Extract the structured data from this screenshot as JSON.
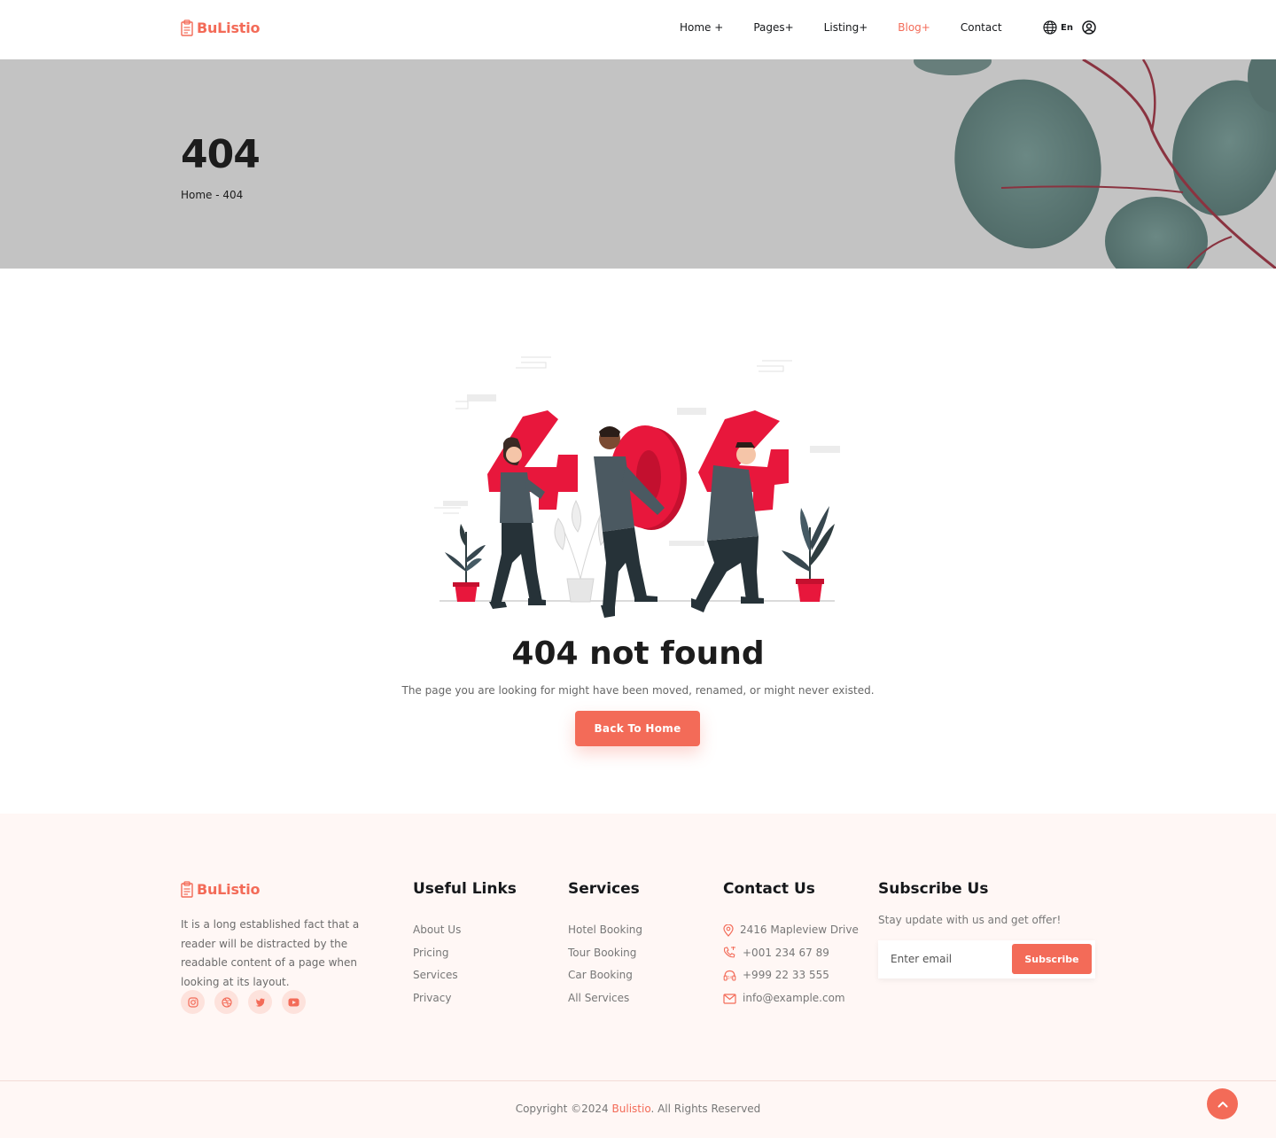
{
  "header": {
    "brand": "BuListio",
    "nav": [
      {
        "label": "Home +",
        "active": false
      },
      {
        "label": "Pages+",
        "active": false
      },
      {
        "label": "Listing+",
        "active": false
      },
      {
        "label": "Blog+",
        "active": true
      },
      {
        "label": "Contact",
        "active": false
      }
    ],
    "language": "En",
    "icons": [
      "globe-icon",
      "user-icon"
    ]
  },
  "hero": {
    "title": "404",
    "breadcrumb": "Home - 404"
  },
  "main": {
    "heading": "404 not found",
    "message": "The page you are looking for might have been moved, renamed, or might never existed.",
    "button": "Back To Home"
  },
  "footer": {
    "brand": "BuListio",
    "about": "It is a long established fact that a reader will be distracted by the readable content of a page when looking at its layout.",
    "socials": [
      "instagram-icon",
      "dribbble-icon",
      "twitter-icon",
      "youtube-icon"
    ],
    "useful_links": {
      "title": "Useful Links",
      "items": [
        "About Us",
        "Pricing",
        "Services",
        "Privacy"
      ]
    },
    "services": {
      "title": "Services",
      "items": [
        "Hotel Booking",
        "Tour Booking",
        "Car Booking",
        "All Services"
      ]
    },
    "contact": {
      "title": "Contact Us",
      "items": [
        {
          "icon": "location-icon",
          "text": "2416 Mapleview Drive"
        },
        {
          "icon": "phone-icon",
          "text": "+001 234 67 89"
        },
        {
          "icon": "headset-icon",
          "text": "+999 22 33 555"
        },
        {
          "icon": "mail-icon",
          "text": "info@example.com"
        }
      ]
    },
    "subscribe": {
      "title": "Subscribe Us",
      "text": "Stay update with us and get offer!",
      "placeholder": "Enter email",
      "button": "Subscribe"
    },
    "copyright_prefix": "Copyright ©2024 ",
    "copyright_brand": "Bulistio",
    "copyright_suffix": ". All Rights Reserved"
  },
  "colors": {
    "accent": "#f36b58",
    "hero_bg": "#c3c3c3",
    "footer_bg": "#fff7f5",
    "illustration_red": "#e8173c"
  }
}
